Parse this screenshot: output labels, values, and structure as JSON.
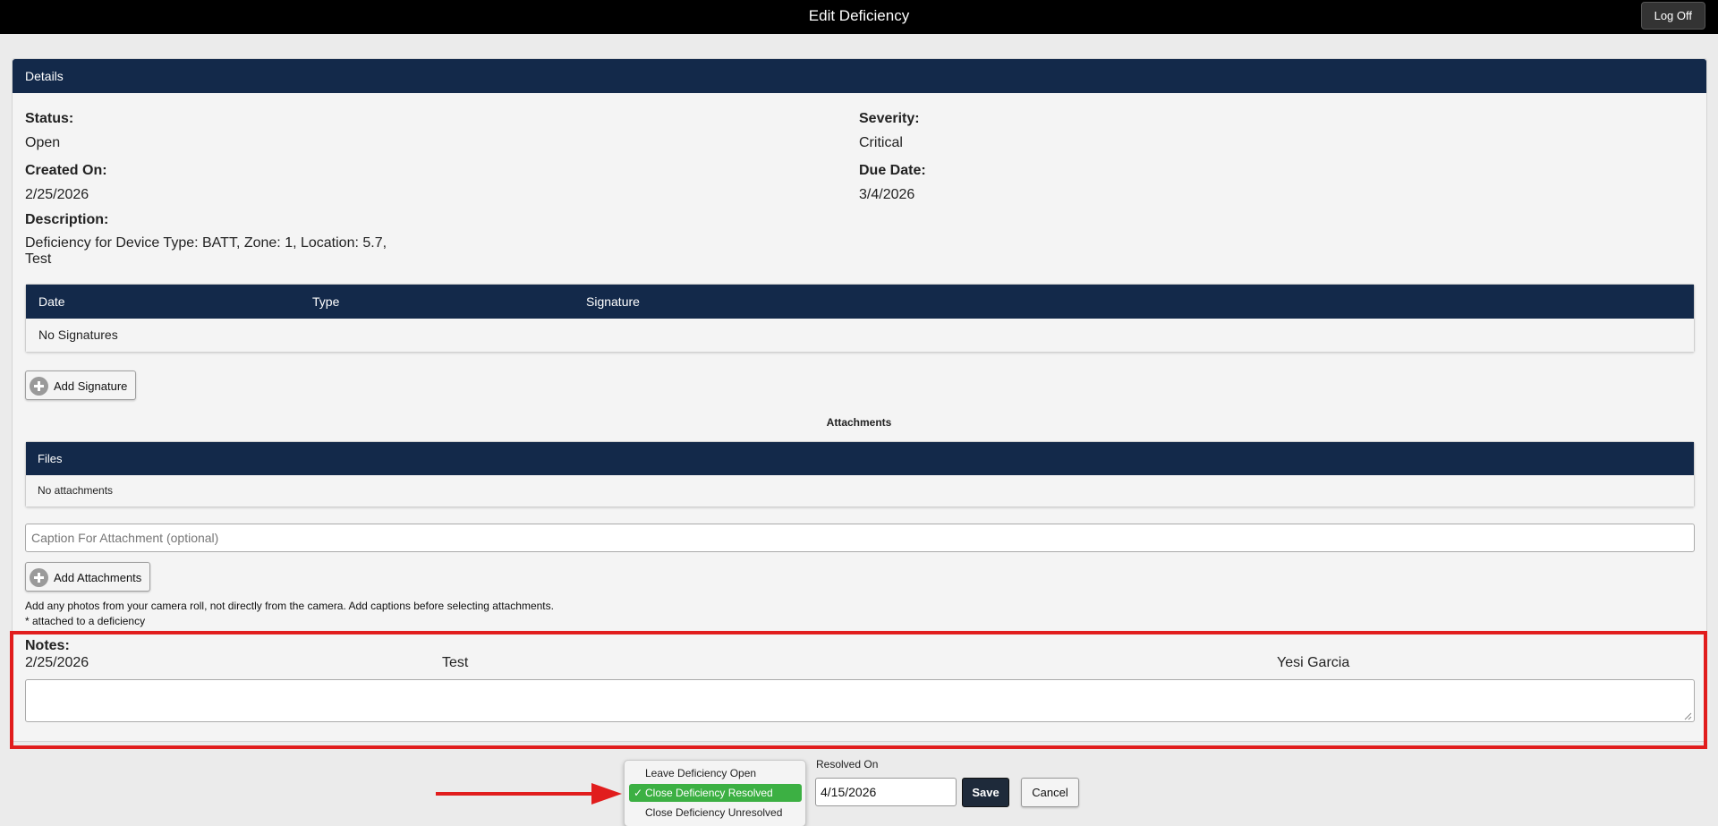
{
  "header": {
    "title": "Edit Deficiency",
    "logoff_label": "Log Off"
  },
  "details": {
    "panel_title": "Details",
    "status_label": "Status:",
    "status_value": "Open",
    "severity_label": "Severity:",
    "severity_value": "Critical",
    "created_label": "Created On:",
    "created_value": "2/25/2026",
    "due_label": "Due Date:",
    "due_value": "3/4/2026",
    "description_label": "Description:",
    "description_line1": "Deficiency for Device Type: BATT, Zone: 1, Location: 5.7,",
    "description_line2": "Test"
  },
  "signatures": {
    "columns": [
      "Date",
      "Type",
      "Signature"
    ],
    "empty_text": "No Signatures",
    "add_label": "Add Signature"
  },
  "attachments": {
    "title": "Attachments",
    "files_header": "Files",
    "empty_text": "No attachments",
    "caption_placeholder": "Caption For Attachment (optional)",
    "add_label": "Add Attachments",
    "help_line1": "Add any photos from your camera roll, not directly from the camera. Add captions before selecting attachments.",
    "help_line2": "* attached to a deficiency"
  },
  "notes": {
    "label": "Notes:",
    "entry": {
      "date": "2/25/2026",
      "text": "Test",
      "author": "Yesi Garcia"
    },
    "highlight_color": "#e11d1d"
  },
  "resolution": {
    "options": [
      "Leave Deficiency Open",
      "Close Deficiency Resolved",
      "Close Deficiency Unresolved"
    ],
    "selected_index": 1,
    "check_mark": "✓",
    "resolved_on_label": "Resolved On",
    "resolved_on_value": "4/15/2026",
    "save_label": "Save",
    "cancel_label": "Cancel"
  },
  "colors": {
    "header_navy": "#13294a",
    "selected_green": "#3cb043",
    "annotation_red": "#e11d1d"
  }
}
